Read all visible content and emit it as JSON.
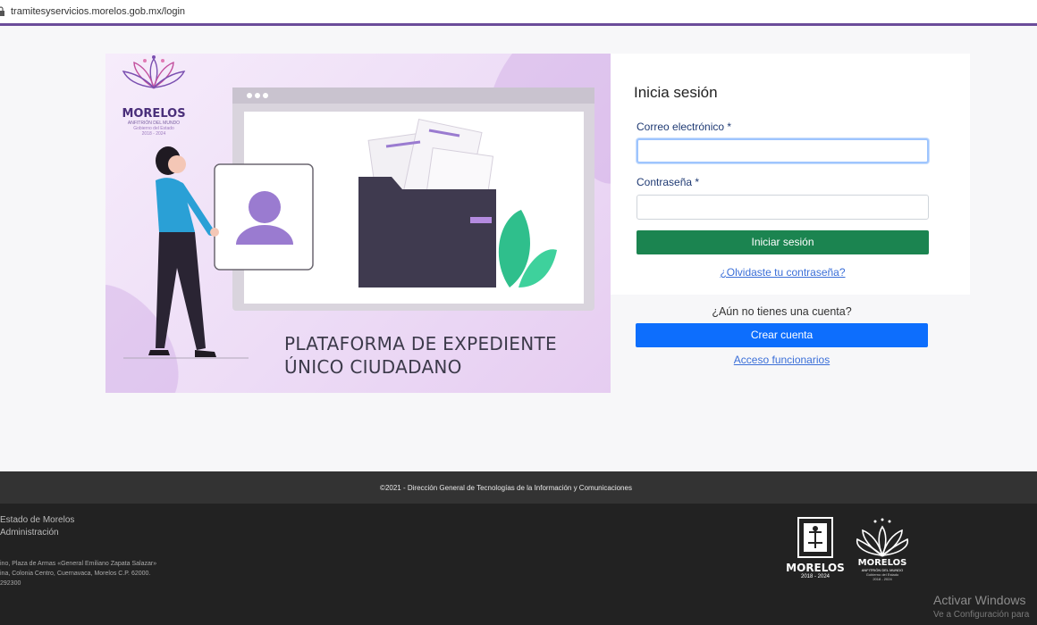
{
  "browser": {
    "url": "tramitesyservicios.morelos.gob.mx/login"
  },
  "colors": {
    "accent": "#6b4c9a",
    "primary_green": "#1b8450",
    "primary_blue": "#0d6efd",
    "link": "#3b6fd8",
    "label": "#1f3a73"
  },
  "hero": {
    "brand_name": "MORELOS",
    "brand_tagline": "ANFITRIÓN DEL MUNDO",
    "brand_gov": "Gobierno del Estado",
    "brand_years": "2018 - 2024",
    "title_line1": "PLATAFORMA DE EXPEDIENTE",
    "title_line2": "ÚNICO CIUDADANO"
  },
  "login": {
    "heading": "Inicia sesión",
    "email_label": "Correo electrónico",
    "password_label": "Contraseña",
    "required_mark": "*",
    "email_value": "",
    "password_value": "",
    "submit_label": "Iniciar sesión",
    "forgot_link": "¿Olvidaste tu contraseña?"
  },
  "signup": {
    "prompt": "¿Aún no tienes una cuenta?",
    "create_label": "Crear cuenta",
    "officials_link": "Acceso funcionarios"
  },
  "footer": {
    "copyright": "©2021 - Dirección General de Tecnologías de la Información y Comunicaciones",
    "org_line1": "Estado de Morelos",
    "org_line2": "Administración",
    "address_line1": "ino, Plaza de Armas «General Emiliano Zapata Salazar»",
    "address_line2": "ina, Colonia Centro, Cuernavaca, Morelos C.P. 62000.",
    "address_line3": "292300",
    "logo1_name": "MORELOS",
    "logo1_years": "2018 - 2024",
    "logo2_name": "MORELOS",
    "logo2_tagline": "ANFITRIÓN DEL MUNDO",
    "logo2_gov": "Gobierno del Estado",
    "logo2_years": "2018 - 2024"
  },
  "os_watermark": {
    "title": "Activar Windows",
    "subtitle": "Ve a Configuración para"
  }
}
